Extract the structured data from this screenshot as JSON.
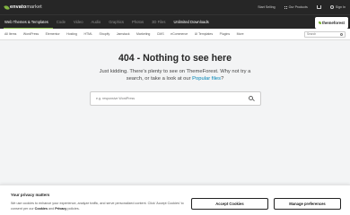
{
  "header": {
    "logo_brand": "envato",
    "logo_suffix": "market",
    "links": {
      "start_selling": "Start Selling",
      "our_products": "Our Products",
      "sign_in": "Sign In"
    }
  },
  "nav": {
    "items": [
      "Web Themes & Templates",
      "Code",
      "Video",
      "Audio",
      "Graphics",
      "Photos",
      "3D Files",
      "Unlimited Downloads"
    ],
    "active_index": 0,
    "badge": "themeforest",
    "accent_color": "#82b541"
  },
  "categories": {
    "items": [
      "All Items",
      "WordPress",
      "Elementor",
      "Hosting",
      "HTML",
      "Shopify",
      "Jamstack",
      "Marketing",
      "CMS",
      "eCommerce",
      "UI Templates",
      "Plugins",
      "More"
    ],
    "search_placeholder": "Search"
  },
  "main": {
    "title": "404 - Nothing to see here",
    "subtitle_pre": "Just kidding. There's plenty to see on ThemeForest. Why not try a search, or take a look at our ",
    "subtitle_link": "Popular files",
    "subtitle_post": "?",
    "search_placeholder": "e.g. responsive WordPress",
    "link_color": "#0084b4"
  },
  "cookie": {
    "title": "Your privacy matters",
    "text_pre": "We use cookies to enhance your experience, analyze traffic, and serve personalized content. Click 'Accept Cookies' to consent per our ",
    "text_cookies": "Cookies",
    "text_mid": " and ",
    "text_privacy": "Privacy",
    "text_post": " policies.",
    "accept_label": "Accept Cookies",
    "prefs_label": "Manage preferences"
  }
}
